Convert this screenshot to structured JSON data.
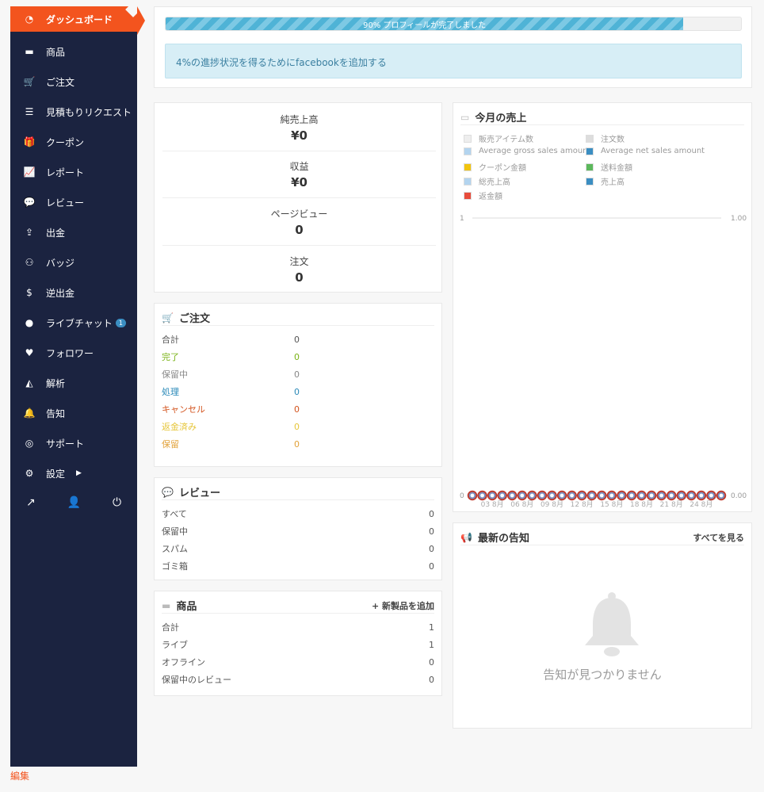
{
  "sidebar": {
    "items": [
      {
        "icon": "dashboard-icon",
        "glyph": "◔",
        "label": "ダッシュボード"
      },
      {
        "icon": "briefcase-icon",
        "glyph": "▬",
        "label": "商品"
      },
      {
        "icon": "cart-icon",
        "glyph": "🛒",
        "label": "ご注文"
      },
      {
        "icon": "list-icon",
        "glyph": "☰",
        "label": "見積もりリクエスト"
      },
      {
        "icon": "gift-icon",
        "glyph": "🎁",
        "label": "クーポン"
      },
      {
        "icon": "line-chart-icon",
        "glyph": "📈",
        "label": "レポート"
      },
      {
        "icon": "comments-icon",
        "glyph": "💬",
        "label": "レビュー"
      },
      {
        "icon": "upload-icon",
        "glyph": "⇪",
        "label": "出金"
      },
      {
        "icon": "badge-icon",
        "glyph": "⚇",
        "label": "バッジ"
      },
      {
        "icon": "dollar-icon",
        "glyph": "$",
        "label": "逆出金"
      },
      {
        "icon": "chat-icon",
        "glyph": "●",
        "label": "ライブチャット",
        "badge": "1"
      },
      {
        "icon": "heart-icon",
        "glyph": "♥",
        "label": "フォロワー"
      },
      {
        "icon": "area-chart-icon",
        "glyph": "◭",
        "label": "解析"
      },
      {
        "icon": "bell-icon",
        "glyph": "🔔",
        "label": "告知"
      },
      {
        "icon": "lifebuoy-icon",
        "glyph": "◎",
        "label": "サポート"
      },
      {
        "icon": "gear-icon",
        "glyph": "⚙",
        "label": "設定",
        "caret": "▶"
      }
    ],
    "bottom": {
      "external": "↗",
      "user": "👤",
      "power": "⏻"
    },
    "edit_label": "編集"
  },
  "profile": {
    "progress_percent": 90,
    "progress_text": "90% プロフィールが完了しました",
    "alert_text": "4%の進捗状況を得るためにfacebookを追加する"
  },
  "stats": [
    {
      "label": "純売上高",
      "value": "¥0"
    },
    {
      "label": "収益",
      "value": "¥0"
    },
    {
      "label": "ページビュー",
      "value": "0"
    },
    {
      "label": "注文",
      "value": "0"
    }
  ],
  "orders": {
    "title": "ご注文",
    "rows": [
      {
        "label": "合計",
        "value": "0",
        "color": "#555555"
      },
      {
        "label": "完了",
        "value": "0",
        "color": "#7ab317"
      },
      {
        "label": "保留中",
        "value": "0",
        "color": "#888888"
      },
      {
        "label": "処理",
        "value": "0",
        "color": "#2a89b8"
      },
      {
        "label": "キャンセル",
        "value": "0",
        "color": "#d3541e"
      },
      {
        "label": "返金済み",
        "value": "0",
        "color": "#e6c63a"
      },
      {
        "label": "保留",
        "value": "0",
        "color": "#e2a23a"
      }
    ]
  },
  "reviews": {
    "title": "レビュー",
    "rows": [
      {
        "label": "すべて",
        "value": "0"
      },
      {
        "label": "保留中",
        "value": "0"
      },
      {
        "label": "スパム",
        "value": "0"
      },
      {
        "label": "ゴミ箱",
        "value": "0"
      }
    ]
  },
  "products": {
    "title": "商品",
    "add_label": "+ 新製品を追加",
    "rows": [
      {
        "label": "合計",
        "value": "1"
      },
      {
        "label": "ライブ",
        "value": "1"
      },
      {
        "label": "オフライン",
        "value": "0"
      },
      {
        "label": "保留中のレビュー",
        "value": "0"
      }
    ]
  },
  "sales": {
    "title": "今月の売上",
    "legend": [
      {
        "label": "販売アイテム数",
        "color": "#eeeeee"
      },
      {
        "label": "注文数",
        "color": "#dddddd"
      },
      {
        "label": "Average gross sales amount",
        "color": "#b3d4ef"
      },
      {
        "label": "Average net sales amount",
        "color": "#3b8ec2"
      },
      {
        "label": "クーポン金額",
        "color": "#f1c40f"
      },
      {
        "label": "送料金額",
        "color": "#5cb85c"
      },
      {
        "label": "総売上高",
        "color": "#b3d4ef"
      },
      {
        "label": "売上高",
        "color": "#3b8ec2"
      },
      {
        "label": "返金額",
        "color": "#e74c3c"
      }
    ]
  },
  "chart_data": {
    "type": "line",
    "title": "",
    "x_tick_labels": [
      "03 8月",
      "06 8月",
      "09 8月",
      "12 8月",
      "15 8月",
      "18 8月",
      "21 8月",
      "24 8月"
    ],
    "x": [
      1,
      2,
      3,
      4,
      5,
      6,
      7,
      8,
      9,
      10,
      11,
      12,
      13,
      14,
      15,
      16,
      17,
      18,
      19,
      20,
      21,
      22,
      23,
      24,
      25,
      26
    ],
    "series": [
      {
        "name": "販売アイテム数",
        "values": [
          0,
          0,
          0,
          0,
          0,
          0,
          0,
          0,
          0,
          0,
          0,
          0,
          0,
          0,
          0,
          0,
          0,
          0,
          0,
          0,
          0,
          0,
          0,
          0,
          0,
          0
        ]
      },
      {
        "name": "注文数",
        "values": [
          0,
          0,
          0,
          0,
          0,
          0,
          0,
          0,
          0,
          0,
          0,
          0,
          0,
          0,
          0,
          0,
          0,
          0,
          0,
          0,
          0,
          0,
          0,
          0,
          0,
          0
        ]
      }
    ],
    "y_left_ticks": [
      "1",
      "0"
    ],
    "y_right_ticks": [
      "1.00",
      "0.00"
    ],
    "ylim": [
      0,
      1
    ]
  },
  "notices": {
    "title": "最新の告知",
    "view_all": "すべてを見る",
    "empty_text": "告知が見つかりません"
  }
}
